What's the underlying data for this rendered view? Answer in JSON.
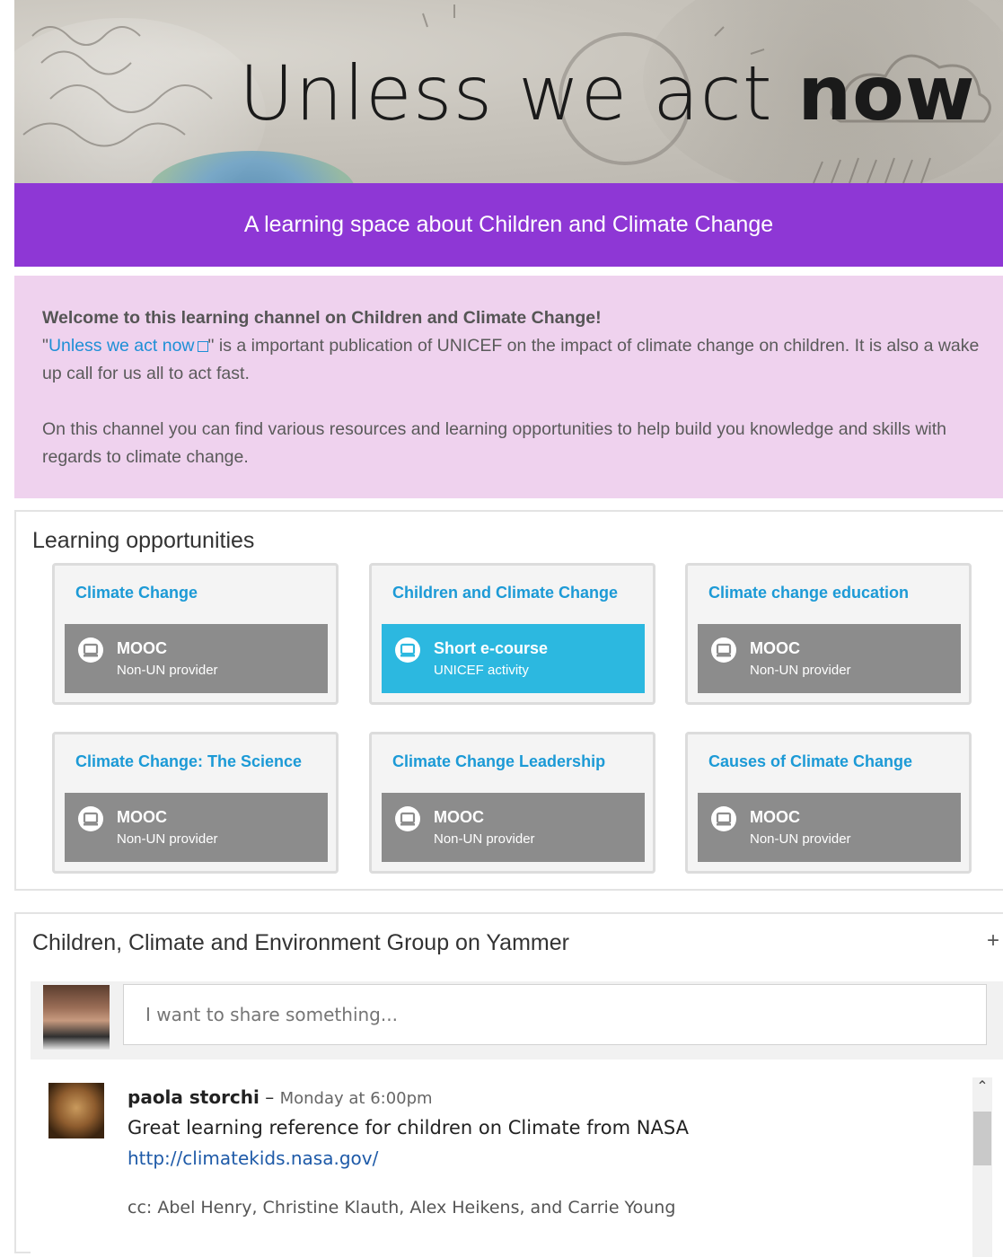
{
  "banner": {
    "title_light": "Unless we act ",
    "title_bold": "now"
  },
  "subtitle_bar": {
    "text": "A learning space about Children and Climate Change"
  },
  "welcome": {
    "heading": "Welcome to this learning channel on Children and Climate Change!",
    "quote_open": "\"",
    "link_text": "Unless we act now",
    "body_after_link": "\" is a important publication of UNICEF on the impact of climate change on children. It is also a wake up call for us all to act fast.",
    "paragraph2": "On this channel you can find various resources and learning opportunities to help build you knowledge and skills with regards to climate change."
  },
  "learning": {
    "title": "Learning opportunities",
    "cards": [
      {
        "title": "Climate Change",
        "type": "MOOC",
        "provider": "Non-UN provider",
        "highlight": false
      },
      {
        "title": "Children and Climate Change",
        "type": "Short e-course",
        "provider": "UNICEF activity",
        "highlight": true
      },
      {
        "title": "Climate change education",
        "type": "MOOC",
        "provider": "Non-UN provider",
        "highlight": false
      },
      {
        "title": "Climate Change: The Science",
        "type": "MOOC",
        "provider": "Non-UN provider",
        "highlight": false
      },
      {
        "title": "Climate Change Leadership",
        "type": "MOOC",
        "provider": "Non-UN provider",
        "highlight": false
      },
      {
        "title": "Causes of Climate Change",
        "type": "MOOC",
        "provider": "Non-UN provider",
        "highlight": false
      }
    ]
  },
  "yammer": {
    "title": "Children, Climate and Environment Group on Yammer",
    "expand_symbol": "+",
    "share_placeholder": "I want to share something...",
    "post": {
      "author": "paola storchi",
      "separator": " – ",
      "time": "Monday at 6:00pm",
      "body": "Great learning reference for children on Climate from NASA",
      "link": "http://climatekids.nasa.gov/",
      "cc": "cc: Abel Henry, Christine Klauth, Alex Heikens, and Carrie Young"
    }
  },
  "colors": {
    "purple_bar": "#8e37d5",
    "welcome_bg": "#efd2ee",
    "card_title": "#1c9ad6",
    "tag_gray": "#8c8c8c",
    "tag_blue": "#2cb8e0",
    "link": "#1e8fd6"
  },
  "icons": {
    "card_tag_icon": "monitor-icon",
    "external_link_icon": "external-link-icon"
  }
}
